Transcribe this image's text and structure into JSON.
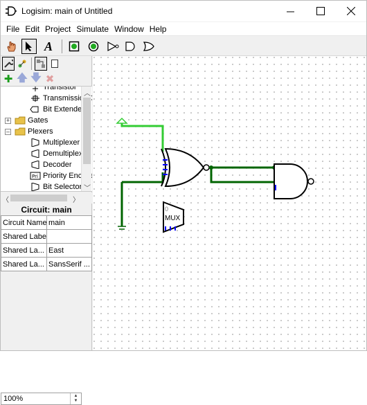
{
  "window": {
    "title": "Logisim: main of Untitled",
    "controls": {
      "minimize": "minimize",
      "maximize": "maximize",
      "close": "close"
    }
  },
  "menu": {
    "items": [
      "File",
      "Edit",
      "Project",
      "Simulate",
      "Window",
      "Help"
    ]
  },
  "toolbar": {
    "tools": [
      "poke-tool",
      "select-tool",
      "text-tool",
      "input-pin",
      "output-pin",
      "not-gate",
      "and-gate",
      "or-gate"
    ],
    "text_tool_glyph": "A"
  },
  "explorer": {
    "tree": [
      {
        "label": "Transistor",
        "indent": 2,
        "icon": "transistor-icon"
      },
      {
        "label": "Transmission Gate",
        "indent": 2,
        "icon": "transmission-gate-icon"
      },
      {
        "label": "Bit Extender",
        "indent": 2,
        "icon": "bit-extender-icon"
      },
      {
        "label": "Gates",
        "indent": 1,
        "icon": "folder-icon",
        "expander": "+"
      },
      {
        "label": "Plexers",
        "indent": 1,
        "icon": "folder-icon",
        "expander": "−"
      },
      {
        "label": "Multiplexer",
        "indent": 2,
        "icon": "multiplexer-icon"
      },
      {
        "label": "Demultiplexer",
        "indent": 2,
        "icon": "demultiplexer-icon"
      },
      {
        "label": "Decoder",
        "indent": 2,
        "icon": "decoder-icon"
      },
      {
        "label": "Priority Encoder",
        "indent": 2,
        "icon": "priority-encoder-icon"
      },
      {
        "label": "Bit Selector",
        "indent": 2,
        "icon": "bit-selector-icon"
      }
    ]
  },
  "attributes": {
    "title": "Circuit: main",
    "rows": [
      {
        "key": "Circuit Name",
        "value": "main"
      },
      {
        "key": "Shared Label",
        "value": ""
      },
      {
        "key": "Shared La...",
        "value": "East"
      },
      {
        "key": "Shared La...",
        "value": "SansSerif ..."
      }
    ]
  },
  "zoom": {
    "value": "100%"
  },
  "canvas": {
    "mux_label": "MUX",
    "mux_select": "0",
    "colors": {
      "wire_on": "#33cc33",
      "wire_off": "#006400",
      "pin_in": "#0000ff"
    }
  }
}
